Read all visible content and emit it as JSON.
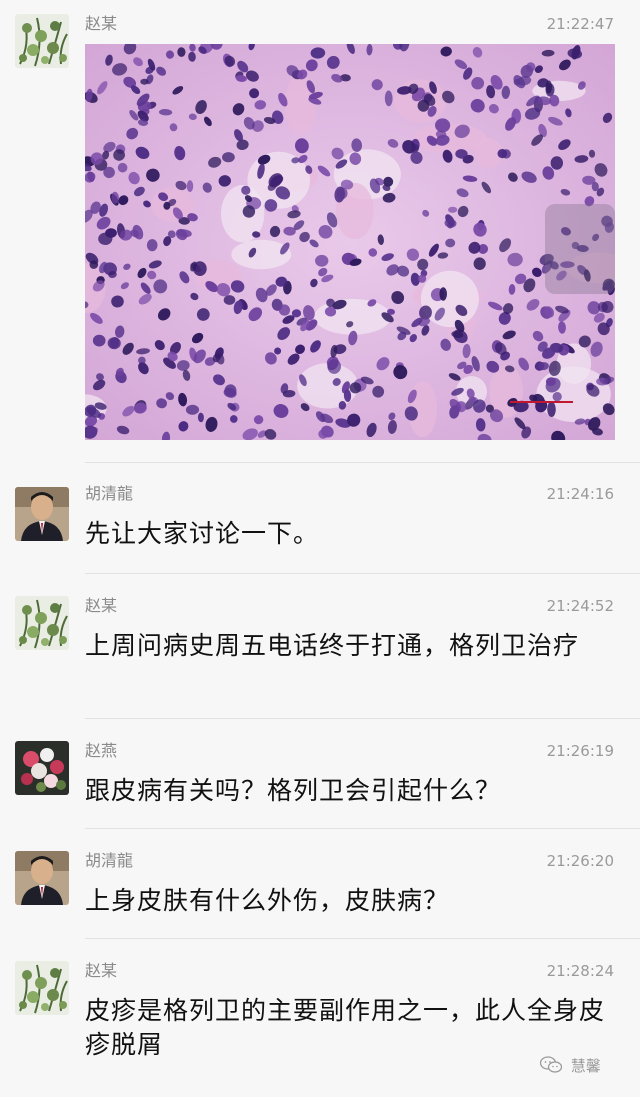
{
  "messages": [
    {
      "sender": "赵某",
      "time": "21:22:47",
      "type": "image",
      "avatar": "plant-avatar",
      "image_label": "histology-he-stain-image"
    },
    {
      "sender": "胡清龍",
      "time": "21:24:16",
      "type": "text",
      "text": "先让大家讨论一下。",
      "avatar": "man-suit-avatar"
    },
    {
      "sender": "赵某",
      "time": "21:24:52",
      "type": "text",
      "text": "上周问病史周五电话终于打通，格列卫治疗",
      "avatar": "plant-avatar"
    },
    {
      "sender": "赵燕",
      "time": "21:26:19",
      "type": "text",
      "text": "跟皮病有关吗？格列卫会引起什么？",
      "avatar": "flowers-avatar"
    },
    {
      "sender": "胡清龍",
      "time": "21:26:20",
      "type": "text",
      "text": "上身皮肤有什么外伤，皮肤病？",
      "avatar": "man-suit-avatar"
    },
    {
      "sender": "赵某",
      "time": "21:28:24",
      "type": "text",
      "text": "皮疹是格列卫的主要副作用之一，此人全身皮疹脱屑",
      "avatar": "plant-avatar"
    }
  ],
  "watermark": {
    "text": "慧馨",
    "icon": "wechat-bubble-icon"
  }
}
